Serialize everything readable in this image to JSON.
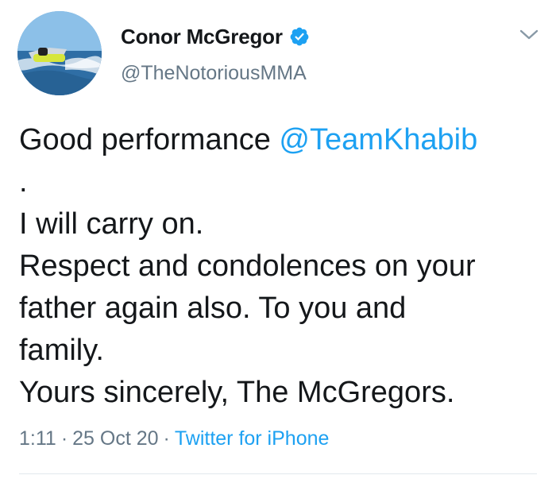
{
  "author": {
    "display_name": "Conor McGregor",
    "handle": "@TheNotoriousMMA",
    "verified": true,
    "verified_color": "#1da1f2"
  },
  "tweet": {
    "line1_prefix": "Good performance ",
    "line1_mention": "@TeamKhabib",
    "line2": ".",
    "line3": "I will carry on.",
    "line4": "Respect and condolences on your",
    "line5": "father again also. To you and",
    "line6": "family.",
    "line7": "Yours sincerely, The McGregors."
  },
  "meta": {
    "time": "1:11",
    "separator": "·",
    "date": "25 Oct 20",
    "source": "Twitter for iPhone"
  },
  "colors": {
    "link": "#1da1f2",
    "muted": "#657786",
    "text": "#14171a"
  },
  "icons": {
    "avatar": "jetski-photo",
    "verified": "verified-badge-icon",
    "menu": "chevron-down-icon"
  }
}
